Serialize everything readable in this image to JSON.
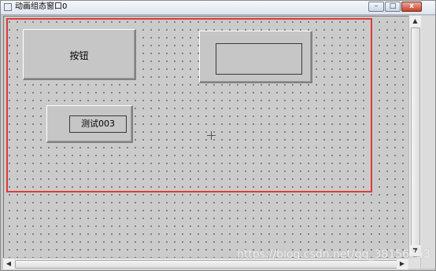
{
  "window": {
    "title": "动画组态窗口0",
    "controls": {
      "minimize": "–",
      "maximize": "□",
      "close": "x"
    }
  },
  "canvas": {
    "button_label": "按钮",
    "test_label": "测试003",
    "accent_color": "#e03a3a"
  },
  "scrollbars": {
    "up": "▲",
    "down": "▼",
    "left": "◀",
    "right": "▶"
  },
  "watermark": "https://blog.csdn.net/qq_38156753"
}
